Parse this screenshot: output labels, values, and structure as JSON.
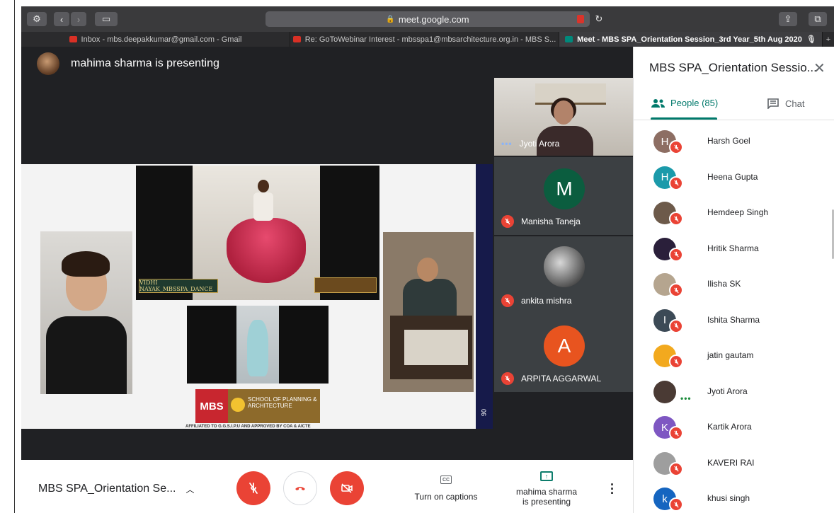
{
  "browser": {
    "url": "meet.google.com",
    "tabs": [
      {
        "label": "Inbox - mbs.deepakkumar@gmail.com - Gmail",
        "favicon": "gmail-icon"
      },
      {
        "label": "Re: GoToWebinar Interest - mbsspa1@mbsarchitecture.org.in - MBS S...",
        "favicon": "gmail-icon"
      },
      {
        "label": "Meet - MBS SPA_Orientation Session_3rd Year_5th Aug 2020",
        "favicon": "meet-icon",
        "active": true
      }
    ]
  },
  "stage": {
    "presenting_label": "mahima sharma is presenting",
    "slide": {
      "banner_top": "VIDHI NAYAK_MBSSPA_DANCE",
      "logo_mbs": "MBS",
      "logo_school": "SCHOOL OF PLANNING & ARCHITECTURE",
      "affiliation": "AFFILIATED TO G.G.S.I.P.U AND APPROVED BY COA & AICTE",
      "side_number": "06"
    },
    "tiles": [
      {
        "name": "Jyoti Arora",
        "type": "camera",
        "speaking": true
      },
      {
        "name": "Manisha Taneja",
        "type": "initial",
        "initial": "M",
        "color": "#0b5d3f",
        "muted": true
      },
      {
        "name": "ankita mishra",
        "type": "photo",
        "muted": true
      },
      {
        "name": "ARPITA AGGARWAL",
        "type": "initial",
        "initial": "A",
        "color": "#e8541f",
        "muted": true
      }
    ]
  },
  "controls": {
    "meeting_title": "MBS SPA_Orientation Se...",
    "captions_label": "Turn on captions",
    "presenting_line1": "mahima sharma",
    "presenting_line2": "is presenting",
    "cc_glyph": "CC"
  },
  "panel": {
    "title": "MBS SPA_Orientation Sessio...",
    "people_tab": "People (85)",
    "chat_tab": "Chat",
    "people": [
      {
        "name": "Harsh Goel",
        "initial": "H",
        "color": "#8d6e63",
        "muted": true
      },
      {
        "name": "Heena Gupta",
        "initial": "H",
        "color": "#1b9aaa",
        "muted": true
      },
      {
        "name": "Hemdeep Singh",
        "initial": "",
        "color": "#6d5a4a",
        "muted": true
      },
      {
        "name": "Hritik Sharma",
        "initial": "",
        "color": "#2a1f3a",
        "muted": true
      },
      {
        "name": "Ilisha SK",
        "initial": "",
        "color": "#b5a58f",
        "muted": true
      },
      {
        "name": "Ishita Sharma",
        "initial": "I",
        "color": "#3c4a56",
        "muted": true
      },
      {
        "name": "jatin gautam",
        "initial": "",
        "color": "#f2a91e",
        "muted": true
      },
      {
        "name": "Jyoti Arora",
        "initial": "",
        "color": "#4a3a34",
        "muted": false
      },
      {
        "name": "Kartik Arora",
        "initial": "K",
        "color": "#7e57c2",
        "muted": true
      },
      {
        "name": "KAVERI RAI",
        "initial": "",
        "color": "#9e9e9e",
        "muted": true
      },
      {
        "name": "khusi singh",
        "initial": "k",
        "color": "#1565c0",
        "muted": true
      }
    ]
  }
}
